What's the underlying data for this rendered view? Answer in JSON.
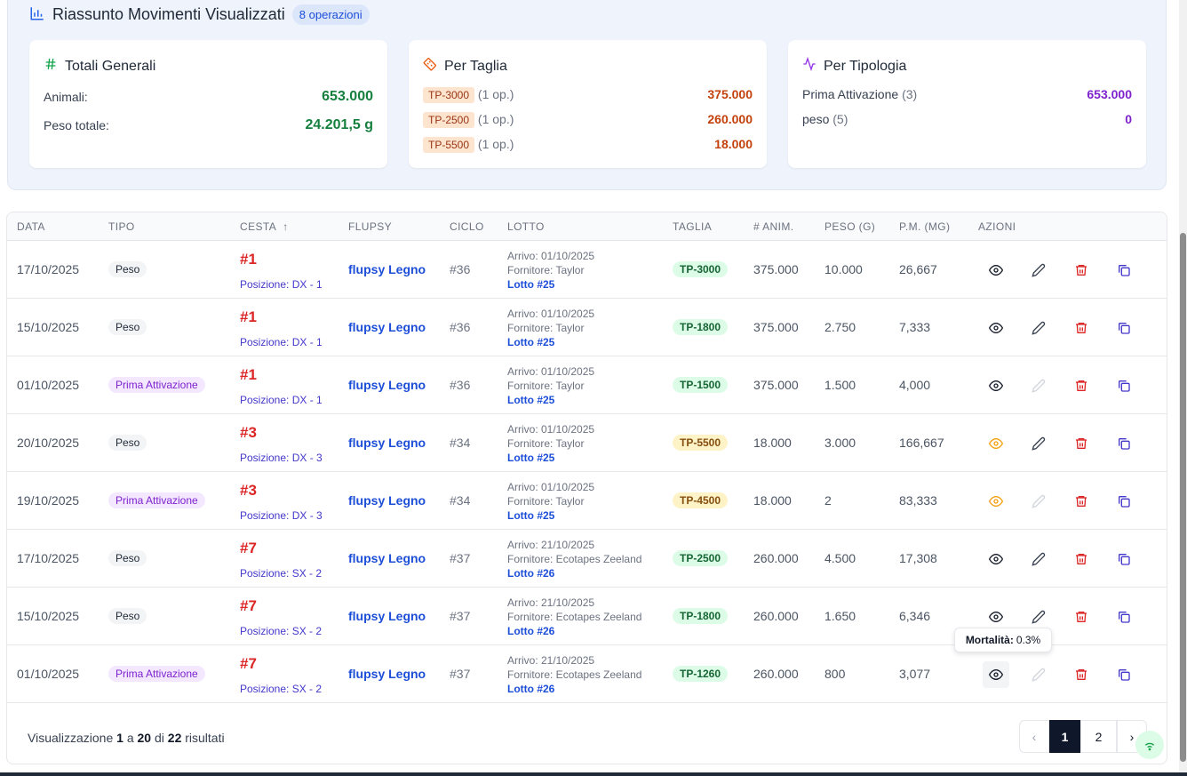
{
  "summary": {
    "title": "Riassunto Movimenti Visualizzati",
    "ops_badge": "8 operazioni",
    "totali": {
      "title": "Totali Generali",
      "animali_label": "Animali:",
      "animali_value": "653.000",
      "peso_label": "Peso totale:",
      "peso_value": "24.201,5 g"
    },
    "taglia": {
      "title": "Per Taglia",
      "items": [
        {
          "code": "TP-3000",
          "ops": "(1 op.)",
          "value": "375.000"
        },
        {
          "code": "TP-2500",
          "ops": "(1 op.)",
          "value": "260.000"
        },
        {
          "code": "TP-5500",
          "ops": "(1 op.)",
          "value": "18.000"
        }
      ]
    },
    "tipologia": {
      "title": "Per Tipologia",
      "items": [
        {
          "label": "Prima Attivazione",
          "count": "(3)",
          "value": "653.000"
        },
        {
          "label": "peso",
          "count": "(5)",
          "value": "0"
        }
      ]
    }
  },
  "table": {
    "headers": {
      "data": "DATA",
      "tipo": "TIPO",
      "cesta": "CESTA",
      "flupsy": "FLUPSY",
      "ciclo": "CICLO",
      "lotto": "LOTTO",
      "taglia": "TAGLIA",
      "anim": "# ANIM.",
      "peso": "PESO (G)",
      "pm": "P.M. (MG)",
      "azioni": "AZIONI"
    },
    "rows": [
      {
        "data": "17/10/2025",
        "tipo": "Peso",
        "cesta": "#1",
        "posizione": "Posizione: DX - 1",
        "flupsy": "flupsy Legno",
        "ciclo": "#36",
        "arrivo": "Arrivo: 01/10/2025",
        "fornitore": "Fornitore: Taylor",
        "lotto": "Lotto #25",
        "taglia": "TP-3000",
        "anim": "375.000",
        "peso": "10.000",
        "pm": "26,667"
      },
      {
        "data": "15/10/2025",
        "tipo": "Peso",
        "cesta": "#1",
        "posizione": "Posizione: DX - 1",
        "flupsy": "flupsy Legno",
        "ciclo": "#36",
        "arrivo": "Arrivo: 01/10/2025",
        "fornitore": "Fornitore: Taylor",
        "lotto": "Lotto #25",
        "taglia": "TP-1800",
        "anim": "375.000",
        "peso": "2.750",
        "pm": "7,333"
      },
      {
        "data": "01/10/2025",
        "tipo": "Prima Attivazione",
        "cesta": "#1",
        "posizione": "Posizione: DX - 1",
        "flupsy": "flupsy Legno",
        "ciclo": "#36",
        "arrivo": "Arrivo: 01/10/2025",
        "fornitore": "Fornitore: Taylor",
        "lotto": "Lotto #25",
        "taglia": "TP-1500",
        "anim": "375.000",
        "peso": "1.500",
        "pm": "4,000"
      },
      {
        "data": "20/10/2025",
        "tipo": "Peso",
        "cesta": "#3",
        "posizione": "Posizione: DX - 3",
        "flupsy": "flupsy Legno",
        "ciclo": "#34",
        "arrivo": "Arrivo: 01/10/2025",
        "fornitore": "Fornitore: Taylor",
        "lotto": "Lotto #25",
        "taglia": "TP-5500",
        "anim": "18.000",
        "peso": "3.000",
        "pm": "166,667"
      },
      {
        "data": "19/10/2025",
        "tipo": "Prima Attivazione",
        "cesta": "#3",
        "posizione": "Posizione: DX - 3",
        "flupsy": "flupsy Legno",
        "ciclo": "#34",
        "arrivo": "Arrivo: 01/10/2025",
        "fornitore": "Fornitore: Taylor",
        "lotto": "Lotto #25",
        "taglia": "TP-4500",
        "anim": "18.000",
        "peso": "2",
        "pm": "83,333"
      },
      {
        "data": "17/10/2025",
        "tipo": "Peso",
        "cesta": "#7",
        "posizione": "Posizione: SX - 2",
        "flupsy": "flupsy Legno",
        "ciclo": "#37",
        "arrivo": "Arrivo: 21/10/2025",
        "fornitore": "Fornitore: Ecotapes Zeeland",
        "lotto": "Lotto #26",
        "taglia": "TP-2500",
        "anim": "260.000",
        "peso": "4.500",
        "pm": "17,308"
      },
      {
        "data": "15/10/2025",
        "tipo": "Peso",
        "cesta": "#7",
        "posizione": "Posizione: SX - 2",
        "flupsy": "flupsy Legno",
        "ciclo": "#37",
        "arrivo": "Arrivo: 21/10/2025",
        "fornitore": "Fornitore: Ecotapes Zeeland",
        "lotto": "Lotto #26",
        "taglia": "TP-1800",
        "anim": "260.000",
        "peso": "1.650",
        "pm": "6,346"
      },
      {
        "data": "01/10/2025",
        "tipo": "Prima Attivazione",
        "cesta": "#7",
        "posizione": "Posizione: SX - 2",
        "flupsy": "flupsy Legno",
        "ciclo": "#37",
        "arrivo": "Arrivo: 21/10/2025",
        "fornitore": "Fornitore: Ecotapes Zeeland",
        "lotto": "Lotto #26",
        "taglia": "TP-1260",
        "anim": "260.000",
        "peso": "800",
        "pm": "3,077"
      }
    ]
  },
  "footer": {
    "prefix": "Visualizzazione",
    "from": "1",
    "sep1": "a",
    "to": "20",
    "sep2": "di",
    "total": "22",
    "suffix": "risultati"
  },
  "pagination": {
    "page1": "1",
    "page2": "2",
    "prev": "‹",
    "next": "›"
  },
  "tooltip": {
    "label": "Mortalità:",
    "value": "0.3%"
  },
  "colors": {
    "accent": "#1d4ed8",
    "danger": "#dc2626",
    "success": "#15803d",
    "purple": "#7e22ce",
    "warning_eye": "#f59e0b"
  }
}
